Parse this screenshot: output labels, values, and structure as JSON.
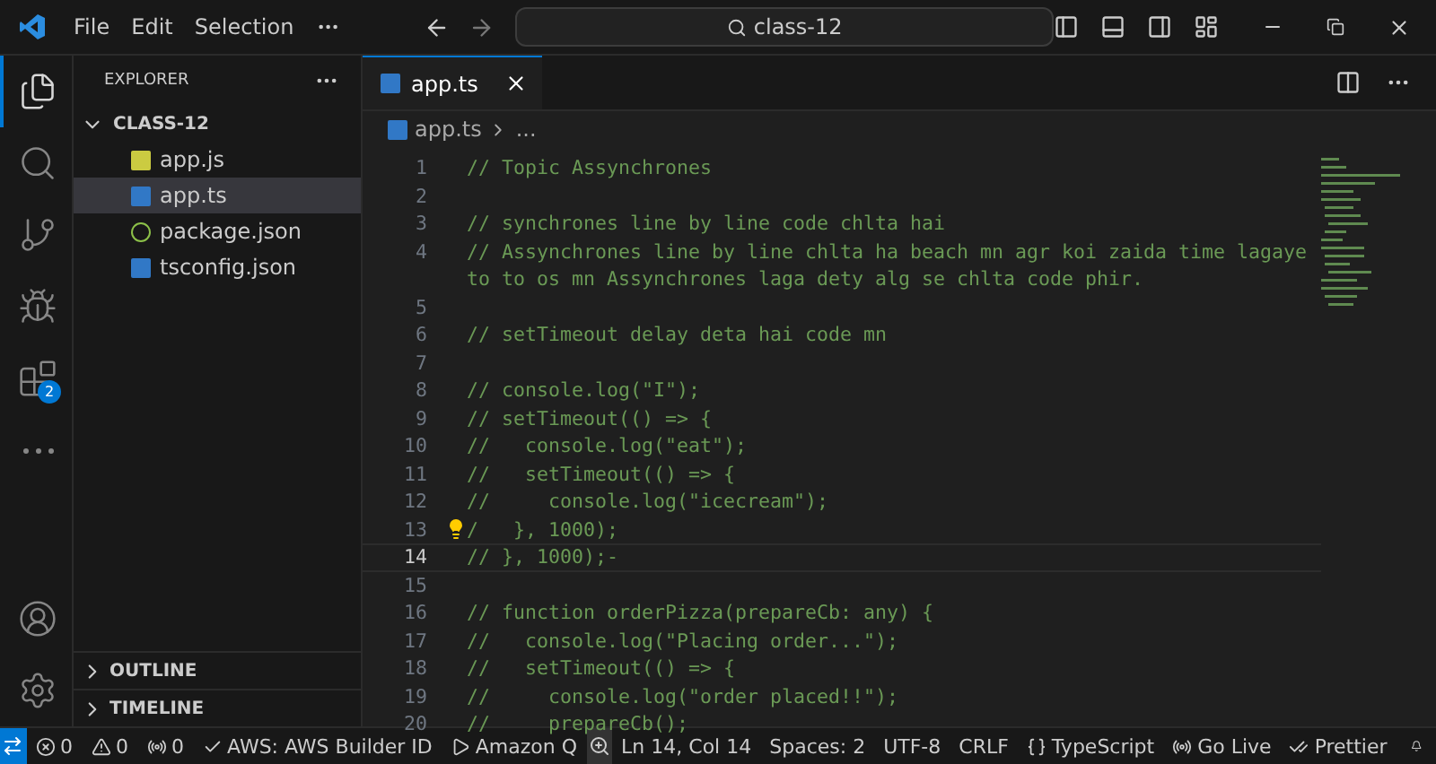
{
  "title_bar": {
    "menu": [
      "File",
      "Edit",
      "Selection"
    ],
    "search": "class-12"
  },
  "activity_bar": {
    "items": [
      {
        "kind": "files",
        "selected": true
      },
      {
        "kind": "search",
        "selected": false
      },
      {
        "kind": "source-control",
        "selected": false
      },
      {
        "kind": "run",
        "selected": false
      },
      {
        "kind": "extensions",
        "selected": false,
        "badge": "2"
      },
      {
        "kind": "more",
        "selected": false
      }
    ],
    "bottom": [
      {
        "kind": "account"
      },
      {
        "kind": "settings"
      }
    ]
  },
  "sidebar": {
    "title": "EXPLORER",
    "folder": {
      "name": "CLASS-12",
      "expanded": true,
      "children": [
        {
          "name": "app.js",
          "kind": "js",
          "selected": false
        },
        {
          "name": "app.ts",
          "kind": "ts",
          "selected": true
        },
        {
          "name": "package.json",
          "kind": "node",
          "selected": false
        },
        {
          "name": "tsconfig.json",
          "kind": "tsconfig",
          "selected": false
        }
      ]
    },
    "sections": [
      {
        "label": "OUTLINE",
        "expanded": false
      },
      {
        "label": "TIMELINE",
        "expanded": false
      }
    ]
  },
  "tabs": [
    {
      "label": "app.ts",
      "selected": true
    }
  ],
  "breadcrumb": [
    "app.ts",
    "..."
  ],
  "code": [
    {
      "number": "1",
      "text": "// Topic Assynchrones",
      "current": false
    },
    {
      "number": "2",
      "current": false
    },
    {
      "number": "3",
      "text": "// synchrones line by line code chlta hai",
      "current": false
    },
    {
      "number": "4",
      "text": "// Assynchrones line by line chlta ha beach mn agr koi zaida time lagaye",
      "continuation": "to to os mn Assynchrones laga dety alg se chlta code phir.",
      "current": false
    },
    {
      "number": "5",
      "current": false
    },
    {
      "number": "6",
      "text": "// setTimeout delay deta hai code mn",
      "current": false
    },
    {
      "number": "7",
      "current": false
    },
    {
      "number": "8",
      "text": "// console.log(\"I\");",
      "current": false
    },
    {
      "number": "9",
      "text": "// setTimeout(() => {",
      "current": false
    },
    {
      "number": "10",
      "text": "//   console.log(\"eat\");",
      "current": false
    },
    {
      "number": "11",
      "text": "//   setTimeout(() => {",
      "current": false
    },
    {
      "number": "12",
      "text": "//     console.log(\"icecream\");",
      "current": false
    },
    {
      "number": "13",
      "text": "/   }, 1000);",
      "current": false,
      "lightbulb": true
    },
    {
      "number": "14",
      "text": "// }, 1000);-",
      "current": true
    },
    {
      "number": "15",
      "current": false
    },
    {
      "number": "16",
      "text": "// function orderPizza(prepareCb: any) {",
      "current": false
    },
    {
      "number": "17",
      "text": "//   console.log(\"Placing order...\");",
      "current": false
    },
    {
      "number": "18",
      "text": "//   setTimeout(() => {",
      "current": false
    },
    {
      "number": "19",
      "text": "//     console.log(\"order placed!!\");",
      "current": false
    },
    {
      "number": "20",
      "text": "//     prepareCb();",
      "current": false
    }
  ],
  "status_bar": {
    "left": [
      {
        "kind": "errors",
        "text": "0"
      },
      {
        "kind": "warnings",
        "text": "0"
      },
      {
        "kind": "ports",
        "text": "0"
      },
      {
        "kind": "account",
        "text": "AWS: AWS Builder ID"
      },
      {
        "kind": "assistant",
        "text": "Amazon Q"
      }
    ],
    "right": [
      {
        "kind": "position",
        "text": "Ln 14, Col 14"
      },
      {
        "kind": "indent",
        "text": "Spaces: 2"
      },
      {
        "kind": "encoding",
        "text": "UTF-8"
      },
      {
        "kind": "eol",
        "text": "CRLF"
      },
      {
        "kind": "language",
        "text": "TypeScript"
      },
      {
        "kind": "live",
        "text": "Go Live"
      },
      {
        "kind": "formatter",
        "text": "Prettier"
      }
    ]
  }
}
